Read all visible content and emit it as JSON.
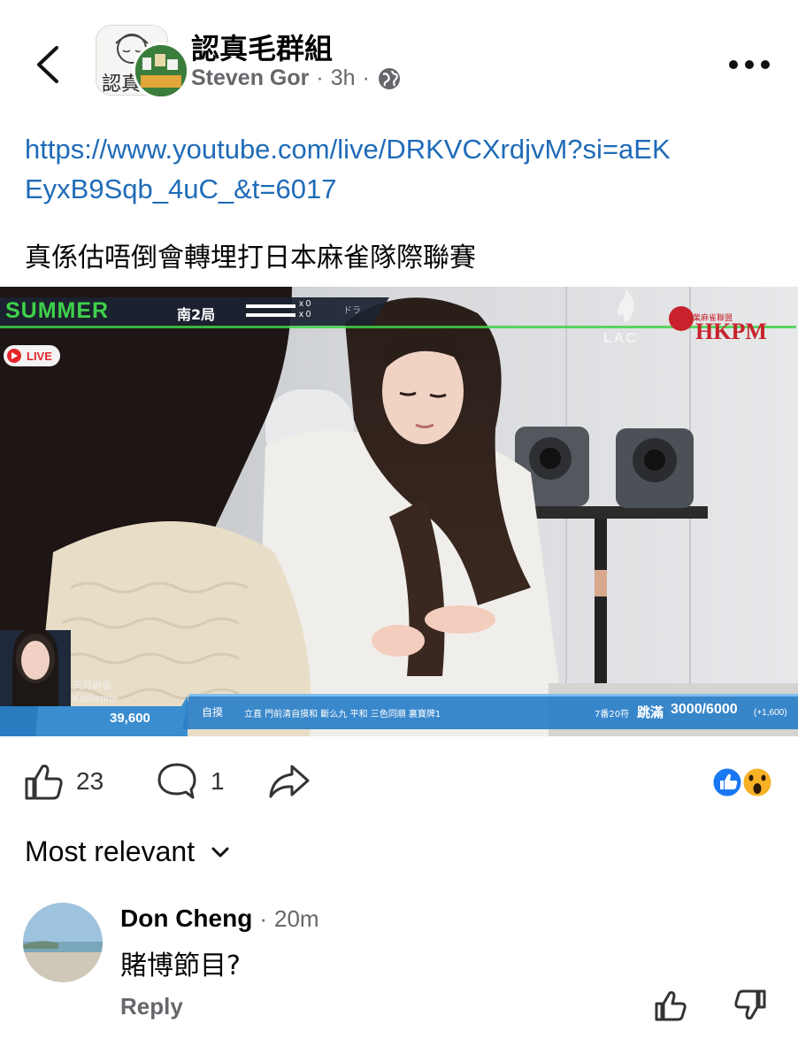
{
  "header": {
    "group_name": "認真毛群組",
    "author": "Steven Gor",
    "separator1": "·",
    "time": "3h",
    "separator2": "·",
    "privacy_icon": "globe-icon",
    "avatar_text": "認真"
  },
  "post": {
    "link": "https://www.youtube.com/live/DRKVCXrdjvM?si=aEKEyxB9Sqb_4uC_&t=6017",
    "text": "真係估唔倒會轉埋打日本麻雀隊際聯賽"
  },
  "video": {
    "summer_label": "SUMMER",
    "round": "南2局",
    "score_a": "x 0",
    "score_b": "x 0",
    "dora_label": "ドラ",
    "live_label": "LIVE",
    "lac_logo": "LAC",
    "hkpm_logo": "HKPM",
    "hkpm_sub": "香港專業麻雀聯盟",
    "player_jp": "天月麻雀",
    "player_name": "Katherine",
    "player_score": "39,600",
    "win_type": "自摸",
    "yaku": "立直 門前清自摸和 斷么九 平和 三色同順 裏寶牌1",
    "han_fu": "7番20符",
    "haneman": "跳滿",
    "points": "3000/6000",
    "bonus": "(+1,600)"
  },
  "actions": {
    "like_count": "23",
    "comment_count": "1"
  },
  "reactions": [
    "like-reaction-icon",
    "wow-reaction-icon"
  ],
  "sort": {
    "label": "Most relevant"
  },
  "comment": {
    "name": "Don Cheng",
    "separator": "·",
    "time": "20m",
    "text": "賭博節目?",
    "reply": "Reply"
  },
  "colors": {
    "link": "#1f6bb8",
    "meta": "#65676b",
    "like_blue": "#1877f2",
    "wow_yellow": "#f7b125",
    "summer_green": "#3fd14a",
    "score_blue": "#2a7fc9"
  }
}
